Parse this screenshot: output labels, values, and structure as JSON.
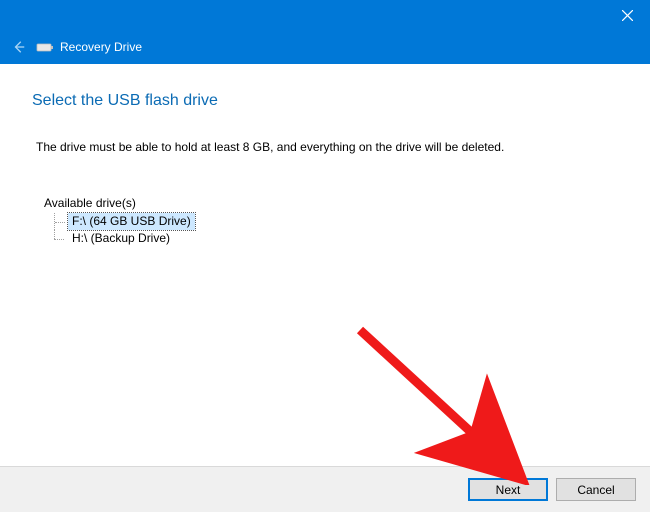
{
  "window": {
    "title": "Recovery Drive"
  },
  "page": {
    "heading": "Select the USB flash drive",
    "description": "The drive must be able to hold at least 8 GB, and everything on the drive will be deleted."
  },
  "drives": {
    "label": "Available drive(s)",
    "items": [
      {
        "text": "F:\\ (64 GB USB Drive)",
        "selected": true
      },
      {
        "text": "H:\\ (Backup Drive)",
        "selected": false
      }
    ]
  },
  "buttons": {
    "next": "Next",
    "cancel": "Cancel"
  }
}
